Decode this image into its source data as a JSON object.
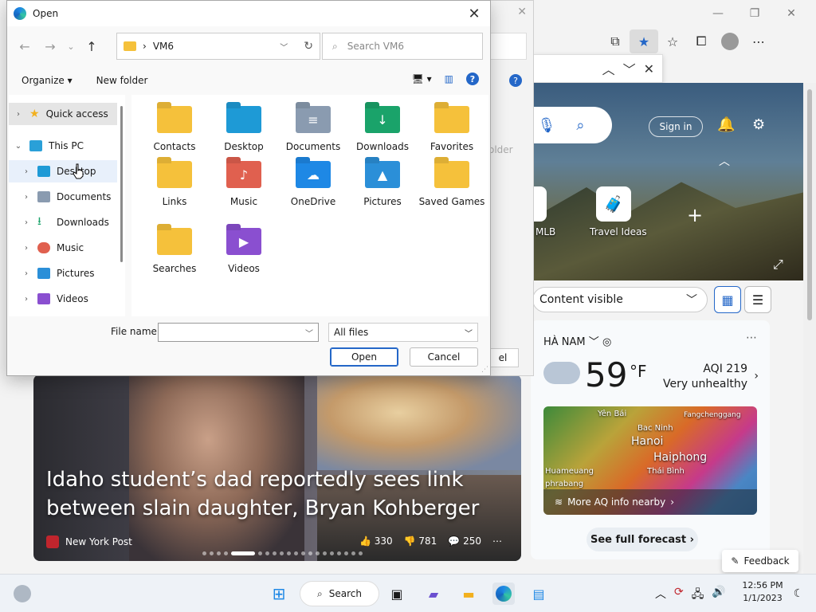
{
  "dialog": {
    "title": "Open",
    "address": {
      "crumb": "VM6"
    },
    "search_placeholder": "Search VM6",
    "commands": {
      "organize": "Organize ▾",
      "new_folder": "New folder",
      "help": "?"
    },
    "nav_tree": [
      {
        "label": "Quick access",
        "icon": "star-icon",
        "color": "#f2b01e"
      },
      {
        "label": "This PC",
        "icon": "computer-icon",
        "color": "#2aa0d8"
      },
      {
        "label": "Desktop",
        "icon": "desktop-folder-icon",
        "color": "#1e9ad6"
      },
      {
        "label": "Documents",
        "icon": "documents-folder-icon",
        "color": "#8a9bb0"
      },
      {
        "label": "Downloads",
        "icon": "downloads-folder-icon",
        "color": "#1aa36a"
      },
      {
        "label": "Music",
        "icon": "music-folder-icon",
        "color": "#e0604f"
      },
      {
        "label": "Pictures",
        "icon": "pictures-folder-icon",
        "color": "#2b8fd8"
      },
      {
        "label": "Videos",
        "icon": "videos-folder-icon",
        "color": "#8a4fd0"
      }
    ],
    "files": [
      {
        "label": "Contacts",
        "icon": "folder-icon",
        "color": "#f5c13b",
        "glyph": ""
      },
      {
        "label": "Desktop",
        "icon": "desktop-folder-icon",
        "color": "#1e9ad6",
        "glyph": ""
      },
      {
        "label": "Documents",
        "icon": "documents-folder-icon",
        "color": "#8a9bb0",
        "glyph": "≡"
      },
      {
        "label": "Downloads",
        "icon": "downloads-folder-icon",
        "color": "#1aa36a",
        "glyph": "↓"
      },
      {
        "label": "Favorites",
        "icon": "folder-icon",
        "color": "#f5c13b",
        "glyph": ""
      },
      {
        "label": "Links",
        "icon": "folder-icon",
        "color": "#f5c13b",
        "glyph": ""
      },
      {
        "label": "Music",
        "icon": "music-folder-icon",
        "color": "#e0604f",
        "glyph": "♪"
      },
      {
        "label": "OneDrive",
        "icon": "onedrive-folder-icon",
        "color": "#1e88e5",
        "glyph": "☁"
      },
      {
        "label": "Pictures",
        "icon": "pictures-folder-icon",
        "color": "#2b8fd8",
        "glyph": "▲"
      },
      {
        "label": "Saved Games",
        "icon": "folder-icon",
        "color": "#f5c13b",
        "glyph": ""
      },
      {
        "label": "Searches",
        "icon": "folder-icon",
        "color": "#f5c13b",
        "glyph": ""
      },
      {
        "label": "Videos",
        "icon": "videos-folder-icon",
        "color": "#8a4fd0",
        "glyph": "▶"
      }
    ],
    "filename_label": "File name:",
    "filename_value": "",
    "filter_value": "All files",
    "open_button": "Open",
    "cancel_button": "Cancel"
  },
  "back_dialog": {
    "folder_header": "older",
    "cancel_partial": "el"
  },
  "browser": {
    "sign_in": "Sign in",
    "tiles": [
      {
        "label": "MLB"
      },
      {
        "label": "Travel Ideas"
      }
    ],
    "content_select": "Content visible",
    "weather": {
      "location": "HÀ NAM",
      "temperature": "59",
      "unit": "°F",
      "aqi": "AQI 219",
      "aqi_status": "Very unhealthy",
      "map_cities": [
        "Yên Bái",
        "Fangchenggang",
        "Bac Ninh",
        "Hanoi",
        "Haiphong",
        "Huameuang",
        "Thái Bình",
        "phrabang"
      ],
      "aq_link": "More AQ info nearby",
      "forecast_button": "See full forecast"
    },
    "news": {
      "headline": "Idaho student’s dad reportedly sees link between slain daughter, Bryan Kohberger",
      "source": "New York Post",
      "likes": "330",
      "dislikes": "781",
      "comments": "250"
    },
    "feedback": "Feedback"
  },
  "taskbar": {
    "search_label": "Search",
    "time": "12:56 PM",
    "date": "1/1/2023"
  }
}
